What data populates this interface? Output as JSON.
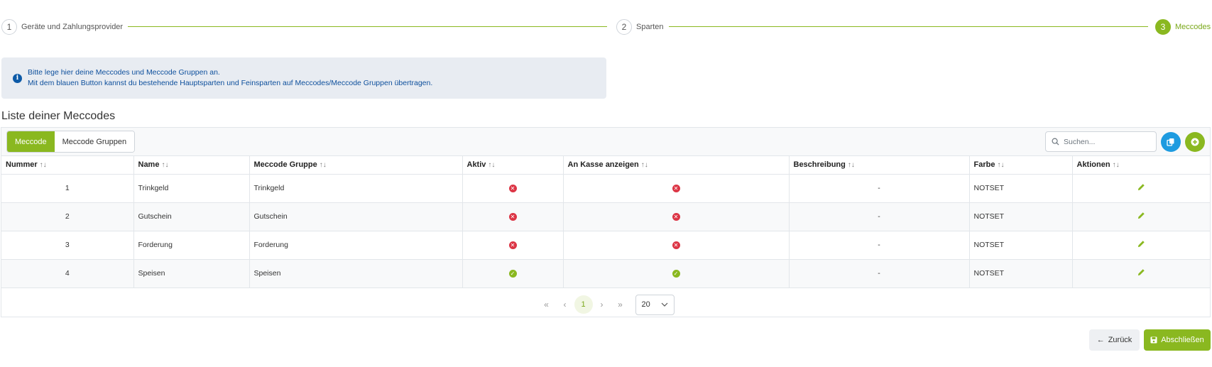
{
  "stepper": {
    "steps": [
      {
        "number": "1",
        "label": "Geräte und Zahlungsprovider",
        "active": false
      },
      {
        "number": "2",
        "label": "Sparten",
        "active": false
      },
      {
        "number": "3",
        "label": "Meccodes",
        "active": true
      }
    ]
  },
  "info": {
    "line1": "Bitte lege hier deine Meccodes und Meccode Gruppen an.",
    "line2": "Mit dem blauen Button kannst du bestehende Hauptsparten und Feinsparten auf Meccodes/Meccode Gruppen übertragen."
  },
  "list_title": "Liste deiner Meccodes",
  "toolbar": {
    "tab_meccode": "Meccode",
    "tab_groups": "Meccode Gruppen",
    "search_placeholder": "Suchen..."
  },
  "table": {
    "columns": [
      "Nummer",
      "Name",
      "Meccode Gruppe",
      "Aktiv",
      "An Kasse anzeigen",
      "Beschreibung",
      "Farbe",
      "Aktionen"
    ],
    "rows": [
      {
        "nummer": "1",
        "name": "Trinkgeld",
        "gruppe": "Trinkgeld",
        "aktiv": false,
        "kasse": false,
        "beschreibung": "-",
        "farbe": "NOTSET"
      },
      {
        "nummer": "2",
        "name": "Gutschein",
        "gruppe": "Gutschein",
        "aktiv": false,
        "kasse": false,
        "beschreibung": "-",
        "farbe": "NOTSET"
      },
      {
        "nummer": "3",
        "name": "Forderung",
        "gruppe": "Forderung",
        "aktiv": false,
        "kasse": false,
        "beschreibung": "-",
        "farbe": "NOTSET"
      },
      {
        "nummer": "4",
        "name": "Speisen",
        "gruppe": "Speisen",
        "aktiv": true,
        "kasse": true,
        "beschreibung": "-",
        "farbe": "NOTSET"
      }
    ]
  },
  "pagination": {
    "first": "«",
    "prev": "‹",
    "current_page": "1",
    "next": "›",
    "last": "»",
    "rows_per_page": "20"
  },
  "footer": {
    "back_label": "Zurück",
    "finish_label": "Abschließen"
  },
  "colors": {
    "accent": "#8ab820",
    "info_blue": "#1e9be0",
    "danger": "#dc3545"
  }
}
